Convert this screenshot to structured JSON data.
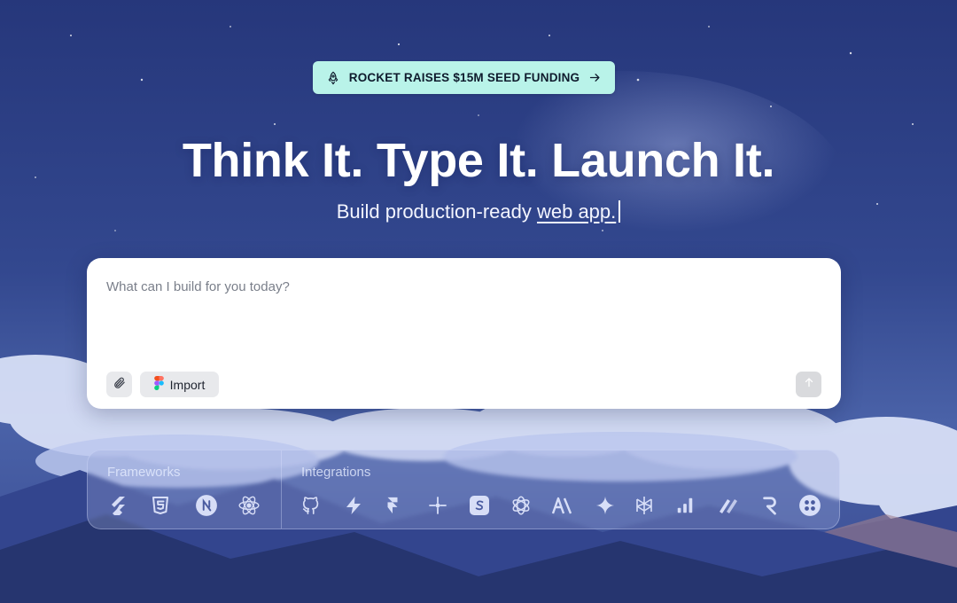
{
  "banner": {
    "label": "ROCKET RAISES $15M SEED FUNDING"
  },
  "hero": {
    "headline": "Think It. Type It. Launch It.",
    "subline_prefix": "Build production-ready ",
    "subline_highlight": "web app."
  },
  "prompt": {
    "placeholder": "What can I build for you today?",
    "import_label": "Import"
  },
  "tools": {
    "frameworks_label": "Frameworks",
    "integrations_label": "Integrations",
    "frameworks": [
      "flutter-icon",
      "html5-icon",
      "nextjs-icon",
      "react-icon"
    ],
    "integrations": [
      "github-icon",
      "supabase-icon",
      "framer-icon",
      "node-network-icon",
      "stripe-icon",
      "openai-icon",
      "anthropic-icon",
      "gemini-icon",
      "perplexity-icon",
      "analytics-icon",
      "mailgun-icon",
      "resend-icon",
      "twilio-icon"
    ]
  },
  "colors": {
    "banner_bg": "#b9f3e9",
    "sky_top": "#27387d",
    "card_bg": "#ffffff"
  }
}
